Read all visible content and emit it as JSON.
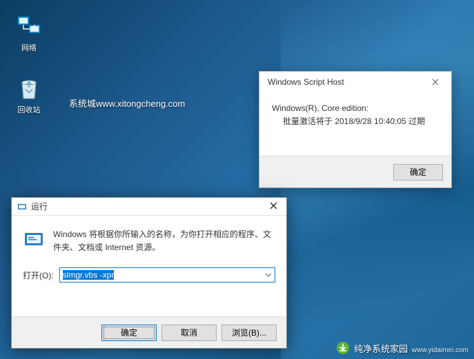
{
  "desktop": {
    "icons": {
      "network": "网络",
      "recycle": "回收站"
    },
    "watermark": "系统城www.xitongcheng.com"
  },
  "wsh": {
    "title": "Windows Script Host",
    "line1": "Windows(R), Core edition:",
    "line2": "批量激活将于 2018/9/28 10:40:05 过期",
    "ok": "确定"
  },
  "run": {
    "title": "运行",
    "description": "Windows 将根据你所输入的名称，为你打开相应的程序、文件夹、文档或 Internet 资源。",
    "open_label": "打开(O):",
    "input_value": "slmgr.vbs -xpr",
    "buttons": {
      "ok": "确定",
      "cancel": "取消",
      "browse": "浏览(B)..."
    }
  },
  "brand": {
    "name": "纯净系统家园",
    "url": "www.yidaimei.com"
  }
}
